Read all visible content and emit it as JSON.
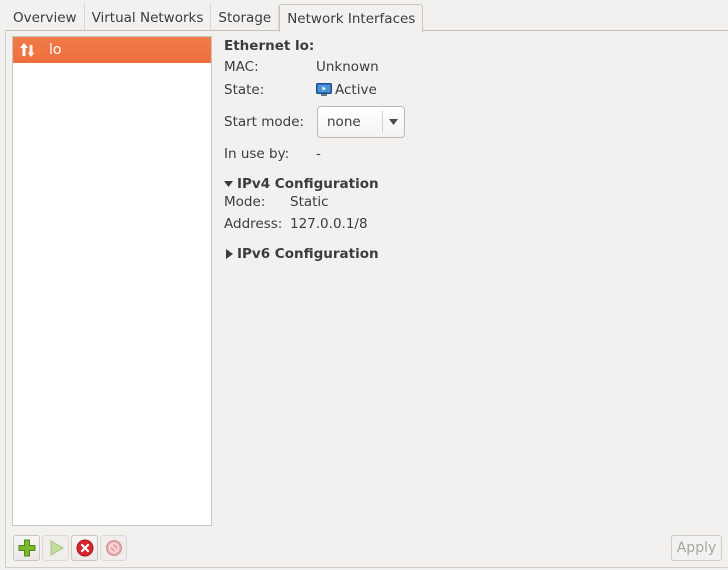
{
  "tabs": [
    {
      "label": "Overview",
      "active": false
    },
    {
      "label": "Virtual Networks",
      "active": false
    },
    {
      "label": "Storage",
      "active": false
    },
    {
      "label": "Network Interfaces",
      "active": true
    }
  ],
  "interfaces": [
    {
      "name": "lo",
      "icon": "network-updown-icon",
      "selected": true
    }
  ],
  "detail": {
    "title": "Ethernet lo:",
    "mac_label": "MAC:",
    "mac_value": "Unknown",
    "state_label": "State:",
    "state_value": "Active",
    "state_icon": "monitor-active-icon",
    "start_mode_label": "Start mode:",
    "start_mode_value": "none",
    "in_use_label": "In use by:",
    "in_use_value": "-",
    "ipv4": {
      "label": "IPv4 Configuration",
      "expanded": true,
      "mode_label": "Mode:",
      "mode_value": "Static",
      "address_label": "Address:",
      "address_value": "127.0.0.1/8"
    },
    "ipv6": {
      "label": "IPv6 Configuration",
      "expanded": false
    }
  },
  "toolbar": {
    "add": "add-icon",
    "start": "start-icon",
    "delete": "delete-icon",
    "stop": "stop-icon"
  },
  "apply_label": "Apply",
  "colors": {
    "selection": "#ef7341",
    "add_green": "#7cb82f",
    "delete_red": "#d8262e"
  }
}
